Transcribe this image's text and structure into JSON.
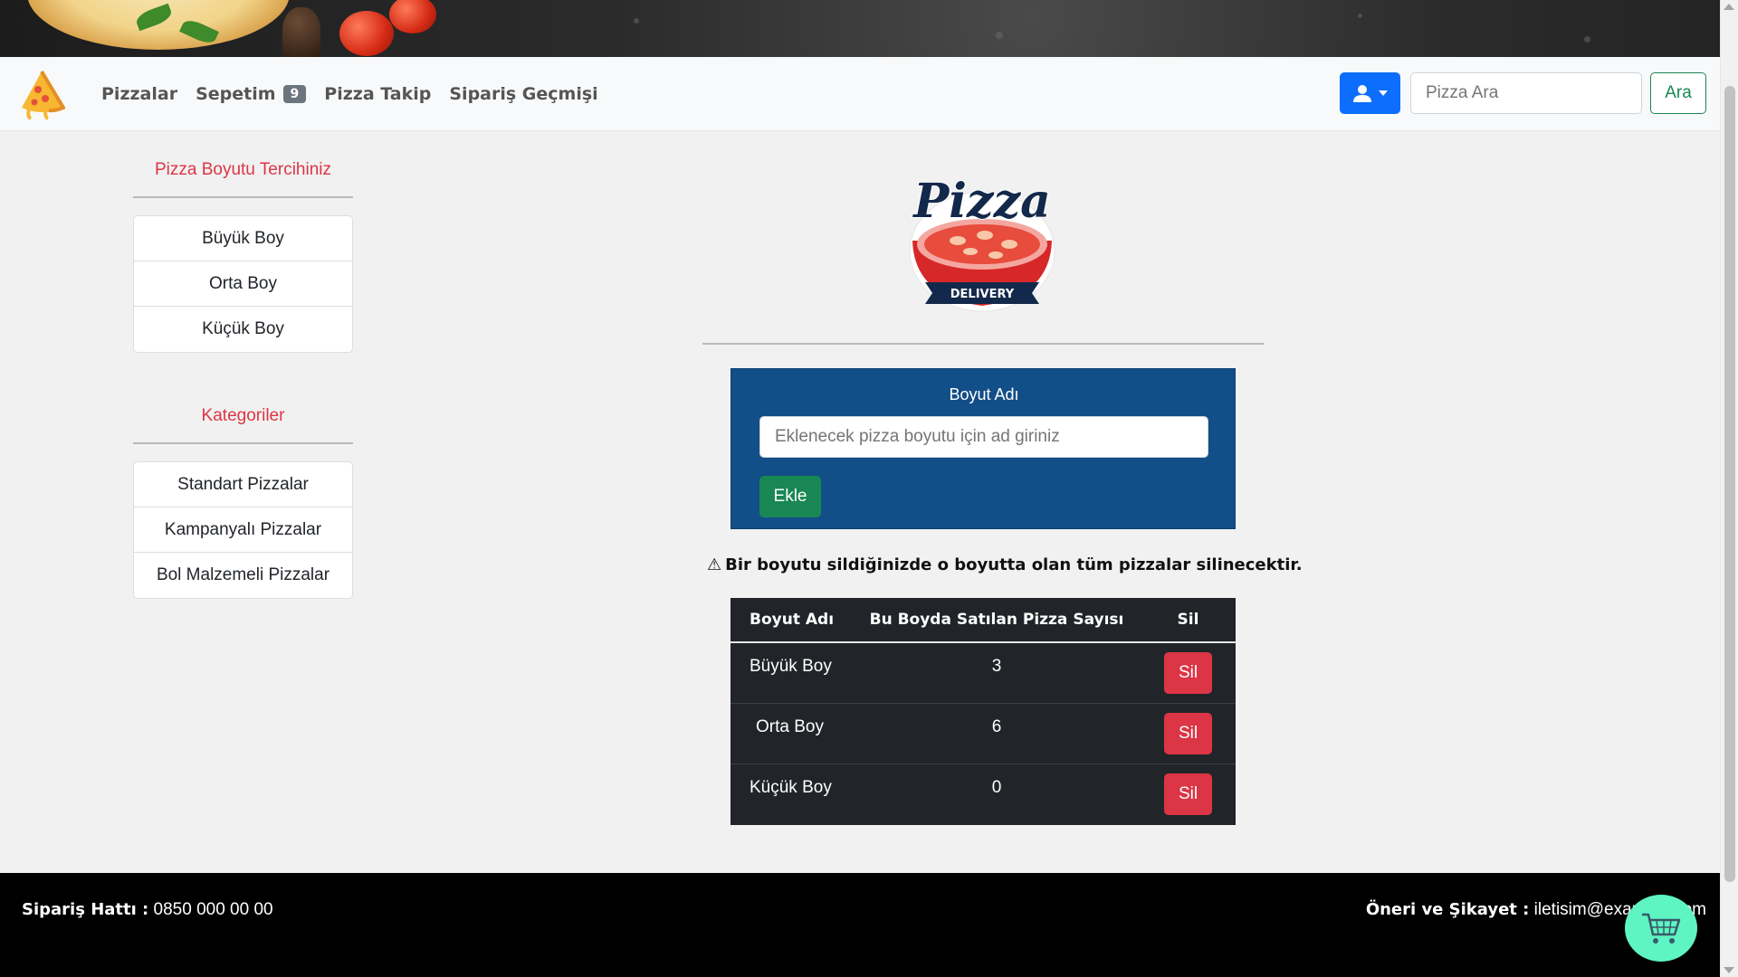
{
  "navbar": {
    "brand_icon": "pizza-slice-icon",
    "links": [
      {
        "label": "Pizzalar"
      },
      {
        "label": "Sepetim",
        "badge": "9"
      },
      {
        "label": "Pizza Takip"
      },
      {
        "label": "Sipariş Geçmişi"
      }
    ],
    "user_icon": "user-dropdown-icon",
    "search_placeholder": "Pizza Ara",
    "search_button": "Ara"
  },
  "sidebar": {
    "size_title": "Pizza Boyutu Tercihiniz",
    "sizes": [
      "Büyük Boy",
      "Orta Boy",
      "Küçük Boy"
    ],
    "category_title": "Kategoriler",
    "categories": [
      "Standart Pizzalar",
      "Kampanyalı Pizzalar",
      "Bol Malzemeli Pizzalar"
    ]
  },
  "logo": {
    "title": "Pizza",
    "subtitle": "DELIVERY"
  },
  "form": {
    "label": "Boyut Adı",
    "placeholder": "Eklenecek pizza boyutu için ad giriniz",
    "submit": "Ekle"
  },
  "warning": {
    "icon": "⚠",
    "text": "Bir boyutu sildiğinizde o boyutta olan tüm pizzalar silinecektir."
  },
  "table": {
    "headers": [
      "Boyut Adı",
      "Bu Boyda Satılan Pizza Sayısı",
      "Sil"
    ],
    "rows": [
      {
        "name": "Büyük Boy",
        "count": "3",
        "action": "Sil"
      },
      {
        "name": "Orta Boy",
        "count": "6",
        "action": "Sil"
      },
      {
        "name": "Küçük Boy",
        "count": "0",
        "action": "Sil"
      }
    ]
  },
  "footer": {
    "left_label": "Sipariş Hattı :",
    "left_value": "0850 000 00 00",
    "right_label": "Öneri ve Şikayet :",
    "right_value": "iletisim@example.com"
  },
  "cart_fab_icon": "shopping-cart-icon",
  "colors": {
    "primary": "#0d6efd",
    "success": "#198754",
    "danger": "#dc3545",
    "form_bg": "#124e87",
    "table_bg": "#212529",
    "fab": "#5ef5c3"
  }
}
